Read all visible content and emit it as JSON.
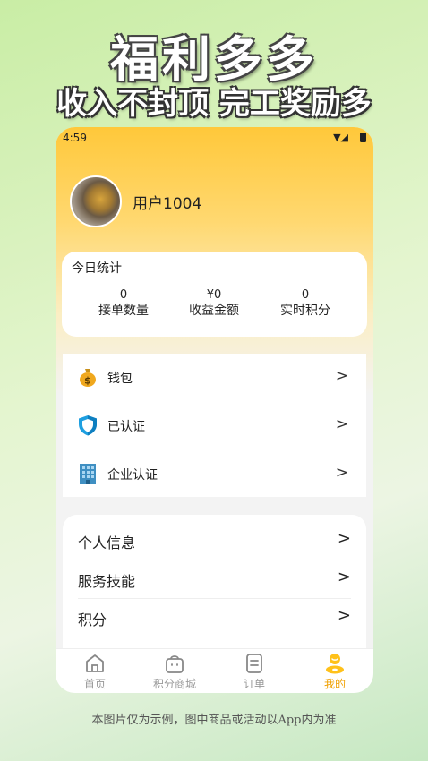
{
  "promo": {
    "title": "福利多多",
    "subtitle": "收入不封顶 完工奖励多"
  },
  "status_bar": {
    "time": "4:59",
    "icons": "▼◢"
  },
  "profile": {
    "username": "用户1004"
  },
  "stats": {
    "title": "今日统计",
    "items": [
      {
        "value": "0",
        "label": "接单数量"
      },
      {
        "value": "¥0",
        "label": "收益金额"
      },
      {
        "value": "0",
        "label": "实时积分"
      }
    ]
  },
  "menu_primary": [
    {
      "label": "钱包",
      "icon": "money-bag-icon",
      "chevron": ">"
    },
    {
      "label": "已认证",
      "icon": "shield-icon",
      "chevron": ">"
    },
    {
      "label": "企业认证",
      "icon": "building-icon",
      "chevron": ">"
    }
  ],
  "menu_secondary": [
    {
      "label": "个人信息",
      "chevron": ">"
    },
    {
      "label": "服务技能",
      "chevron": ">"
    },
    {
      "label": "积分",
      "chevron": ">"
    }
  ],
  "tabs": [
    {
      "label": "首页",
      "icon": "home-icon",
      "active": false
    },
    {
      "label": "积分商城",
      "icon": "shopping-bag-icon",
      "active": false
    },
    {
      "label": "订单",
      "icon": "order-list-icon",
      "active": false
    },
    {
      "label": "我的",
      "icon": "profile-icon",
      "active": true
    }
  ],
  "colors": {
    "accent": "#f0a000",
    "header_top": "#ffc83a",
    "shield": "#1e9fe0",
    "building": "#3f8fc2"
  },
  "disclaimer": "本图片仅为示例，图中商品或活动以App内为准"
}
